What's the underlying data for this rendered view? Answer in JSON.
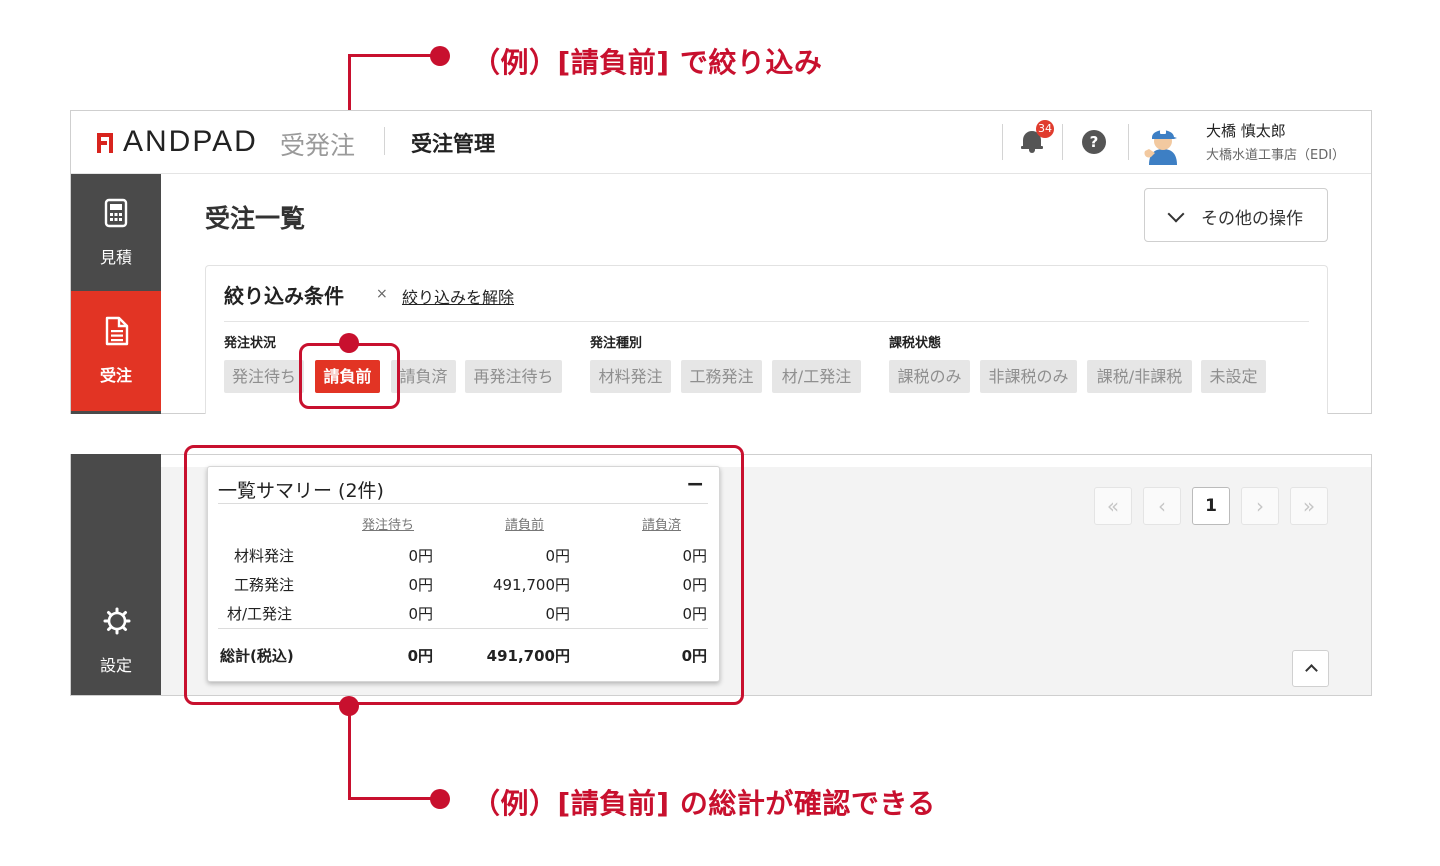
{
  "annotations": {
    "top": "（例）[請負前] で絞り込み",
    "bottom": "（例）[請負前] の総計が確認できる"
  },
  "header": {
    "brand": "ANDPAD",
    "brand_sub": "受発注",
    "app_title": "受注管理",
    "notification_count": "34",
    "help": "?",
    "user_name": "大橋 慎太郎",
    "user_company": "大橋水道工事店（EDI）"
  },
  "sidebar": {
    "items": [
      {
        "label": "見積",
        "icon": "calculator-icon"
      },
      {
        "label": "受注",
        "icon": "document-icon"
      },
      {
        "label": "設定",
        "icon": "gear-icon"
      }
    ]
  },
  "main": {
    "title": "受注一覧",
    "other_actions": "その他の操作",
    "filter": {
      "title": "絞り込み条件",
      "clear_x": "×",
      "clear_label": "絞り込みを解除",
      "groups": [
        {
          "label": "発注状況",
          "chips": [
            "発注待ち",
            "請負前",
            "請負済",
            "再発注待ち"
          ]
        },
        {
          "label": "発注種別",
          "chips": [
            "材料発注",
            "工務発注",
            "材/工発注"
          ]
        },
        {
          "label": "課税状態",
          "chips": [
            "課税のみ",
            "非課税のみ",
            "課税/非課税",
            "未設定"
          ]
        }
      ],
      "active_chip": "請負前"
    },
    "pagination": {
      "first": "«",
      "prev": "‹",
      "current": "1",
      "next": "›",
      "last": "»"
    }
  },
  "summary": {
    "title": "一覧サマリー (2件)",
    "minimize": "−",
    "columns": [
      "発注待ち",
      "請負前",
      "請負済"
    ],
    "rows": [
      {
        "label": "材料発注",
        "values": [
          "0円",
          "0円",
          "0円"
        ]
      },
      {
        "label": "工務発注",
        "values": [
          "0円",
          "491,700円",
          "0円"
        ]
      },
      {
        "label": "材/工発注",
        "values": [
          "0円",
          "0円",
          "0円"
        ]
      }
    ],
    "total": {
      "label": "総計(税込)",
      "values": [
        "0円",
        "491,700円",
        "0円"
      ]
    }
  },
  "colors": {
    "annotation": "#c8102e",
    "accent": "#e23424",
    "sidebar": "#4a4a4a",
    "sidebar_active": "#e23424"
  }
}
